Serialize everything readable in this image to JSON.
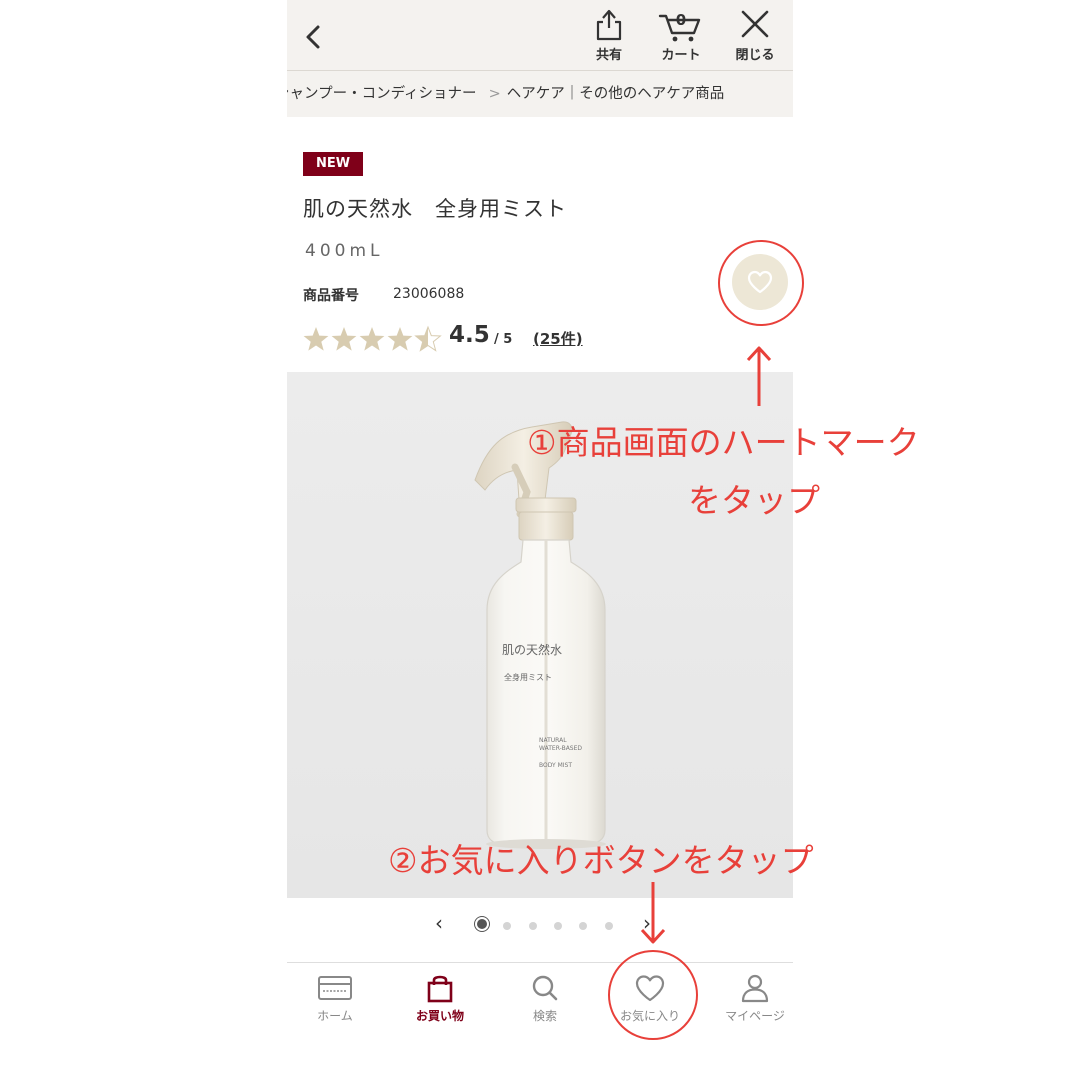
{
  "header": {
    "share_label": "共有",
    "cart_label": "カート",
    "cart_count": "0",
    "close_label": "閉じる"
  },
  "breadcrumb": {
    "items": [
      "シャンプー・コンディショナー",
      "ヘアケア｜その他のヘアケア商品"
    ]
  },
  "product": {
    "badge": "NEW",
    "name": "肌の天然水　全身用ミスト",
    "volume": "400mL",
    "code_label": "商品番号",
    "code": "23006088",
    "rating": "4.5",
    "rating_max": "/ 5",
    "rating_value": 4.5,
    "review_count": "(25件)",
    "image": {
      "label_jp_1": "肌の天然水",
      "label_jp_2": "全身用ミスト",
      "label_en_1": "NATURAL",
      "label_en_2": "WATER-BASED",
      "label_en_3": "BODY MIST"
    }
  },
  "pager": {
    "prev": "‹",
    "next": "›",
    "total": 7,
    "active": 1
  },
  "tabs": [
    {
      "label": "ホーム",
      "icon": "card-icon"
    },
    {
      "label": "お買い物",
      "icon": "bag-icon",
      "active": true
    },
    {
      "label": "検索",
      "icon": "search-icon"
    },
    {
      "label": "お気に入り",
      "icon": "heart-icon"
    },
    {
      "label": "マイページ",
      "icon": "user-icon"
    }
  ],
  "annotations": {
    "step1_line1": "①商品画面のハートマーク",
    "step1_line2": "をタップ",
    "step2": "②お気に入りボタンをタップ"
  },
  "colors": {
    "brand": "#7f0019",
    "annotation": "#e8403a",
    "star": "#d8ccb0",
    "fav_bg": "#ede7d6"
  }
}
